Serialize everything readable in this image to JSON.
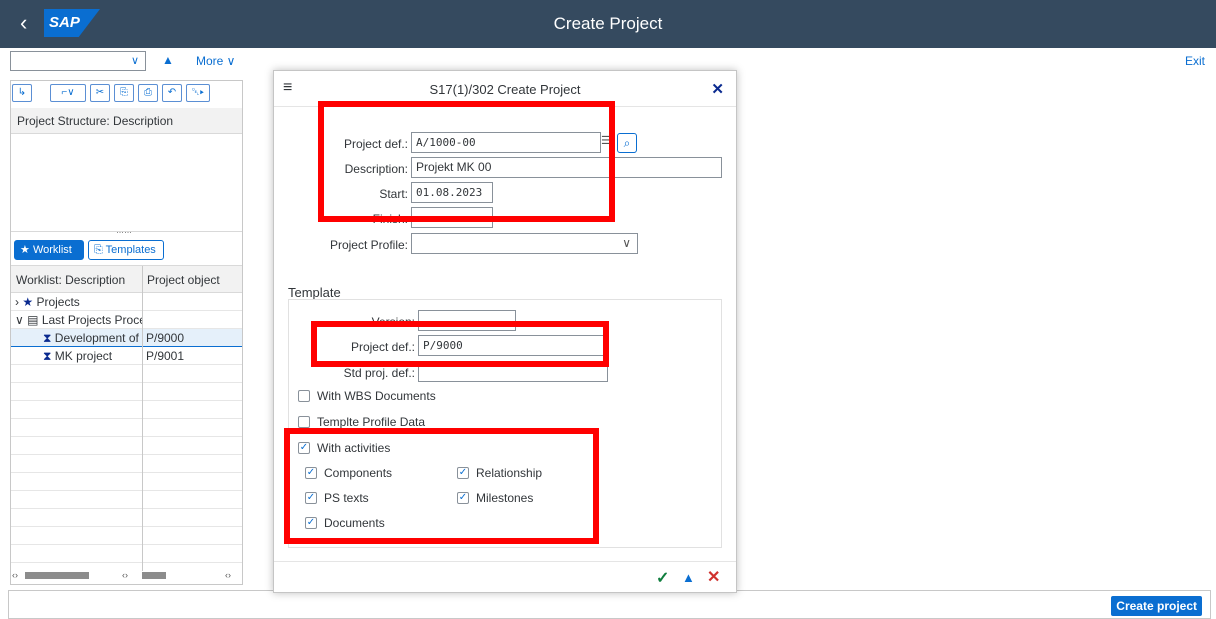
{
  "shell": {
    "title": "Create Project",
    "logo": "SAP",
    "back_icon": "‹"
  },
  "toolbar": {
    "more_label": "More",
    "exit_label": "Exit",
    "combo_value": ""
  },
  "left": {
    "structure_header": "Project Structure: Description",
    "tabs": [
      {
        "label": "Worklist"
      },
      {
        "label": "Templates"
      }
    ],
    "grid_headers": [
      "Worklist: Description",
      "Project object"
    ],
    "rows": [
      {
        "desc": "Projects",
        "obj": ""
      },
      {
        "desc": "Last Projects Proce",
        "obj": ""
      },
      {
        "desc": "Development of",
        "obj": "P/9000"
      },
      {
        "desc": "MK project",
        "obj": "P/9001"
      }
    ]
  },
  "dialog": {
    "title": "S17(1)/302 Create Project",
    "fields": {
      "project_def_label": "Project def.:",
      "project_def_value": "A/1000-00",
      "description_label": "Description:",
      "description_value": "Projekt MK 00",
      "start_label": "Start:",
      "start_value": "01.08.2023",
      "finish_label": "Finish:",
      "finish_value": "",
      "profile_label": "Project Profile:",
      "profile_value": ""
    },
    "template": {
      "title": "Template",
      "version_label": "Version:",
      "version_value": "",
      "project_def_label": "Project def.:",
      "project_def_value": "P/9000",
      "std_label": "Std proj. def.:",
      "std_value": ""
    },
    "checkboxes": {
      "with_wbs": "With WBS Documents",
      "profile_data": "Templte Profile Data",
      "with_activities": "With activities",
      "components": "Components",
      "relationship": "Relationship",
      "ps_texts": "PS texts",
      "milestones": "Milestones",
      "documents": "Documents"
    },
    "checked": {
      "with_wbs": false,
      "profile_data": false,
      "with_activities": true,
      "components": true,
      "relationship": true,
      "ps_texts": true,
      "milestones": true,
      "documents": true
    }
  },
  "footer": {
    "create_label": "Create project"
  },
  "colors": {
    "shell": "#354a5f",
    "accent": "#0a6ed1",
    "highlight": "#ff0000",
    "ok": "#107e3e",
    "cancel": "#d0312d"
  }
}
